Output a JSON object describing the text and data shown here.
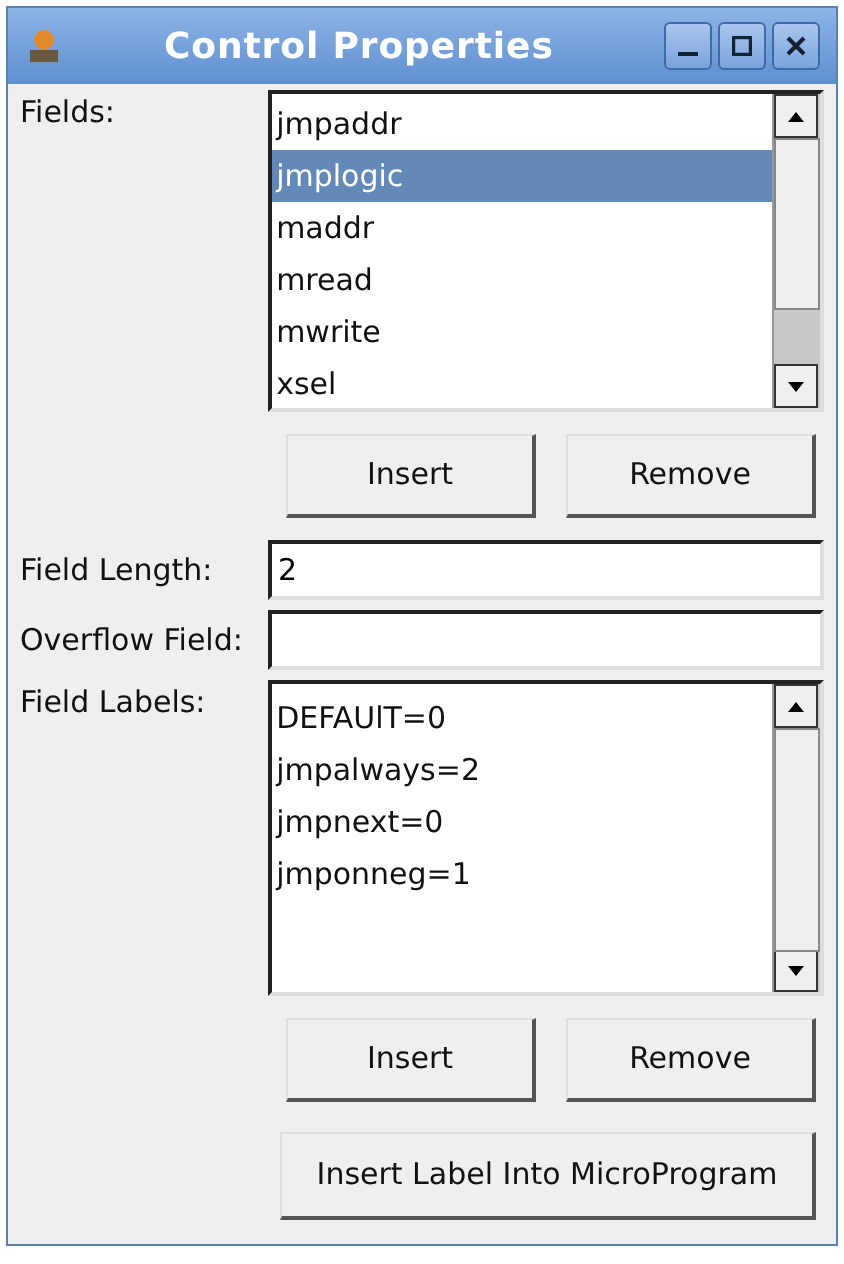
{
  "window": {
    "title": "Control Properties"
  },
  "fields": {
    "label": "Fields:",
    "items": [
      {
        "text": "jmpaddr",
        "selected": false
      },
      {
        "text": "jmplogic",
        "selected": true
      },
      {
        "text": "maddr",
        "selected": false
      },
      {
        "text": "mread",
        "selected": false
      },
      {
        "text": "mwrite",
        "selected": false
      },
      {
        "text": "xsel",
        "selected": false
      }
    ],
    "buttons": [
      "Insert",
      "Remove"
    ]
  },
  "field_length": {
    "label": "Field Length:",
    "value": "2"
  },
  "overflow_field": {
    "label": "Overflow Field:"
  },
  "field_labels": {
    "label": "Field Labels:",
    "items": [
      "DEFAUlT=0",
      "jmpalways=2",
      "jmpnext=0",
      "jmponneg=1"
    ],
    "buttons": [
      "Insert",
      "Remove"
    ]
  },
  "bottom_button": "Insert Label Into MicroProgram"
}
